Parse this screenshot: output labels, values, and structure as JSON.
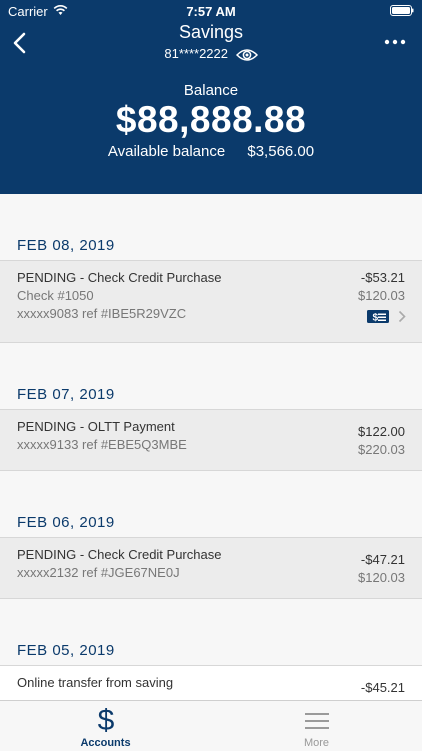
{
  "status": {
    "carrier": "Carrier",
    "time": "7:57 AM"
  },
  "header": {
    "title": "Savings",
    "account_mask": "81****2222",
    "balance_label": "Balance",
    "balance": "$88,888.88",
    "available_label": "Available balance",
    "available_value": "$3,566.00"
  },
  "days": [
    {
      "date": "FEB 08, 2019",
      "txns": [
        {
          "desc": "PENDING - Check Credit Purchase",
          "sub1": "Check #1050",
          "sub2": "xxxxx9083 ref #IBE5R29VZC",
          "amount": "-$53.21",
          "balance": "$120.03"
        }
      ]
    },
    {
      "date": "FEB 07, 2019",
      "txns": [
        {
          "desc": "PENDING - OLTT Payment",
          "sub1": "xxxxx9133 ref #EBE5Q3MBE",
          "amount": "$122.00",
          "balance": "$220.03"
        }
      ]
    },
    {
      "date": "FEB 06, 2019",
      "txns": [
        {
          "desc": "PENDING - Check Credit Purchase",
          "sub1": "xxxxx2132 ref #JGE67NE0J",
          "amount": "-$47.21",
          "balance": "$120.03"
        }
      ]
    },
    {
      "date": "FEB 05, 2019",
      "txns": [
        {
          "desc": "Online transfer from saving",
          "amount": "-$45.21"
        }
      ]
    }
  ],
  "tabs": {
    "accounts": "Accounts",
    "more": "More"
  },
  "colors": {
    "brand": "#0b3a6b"
  }
}
